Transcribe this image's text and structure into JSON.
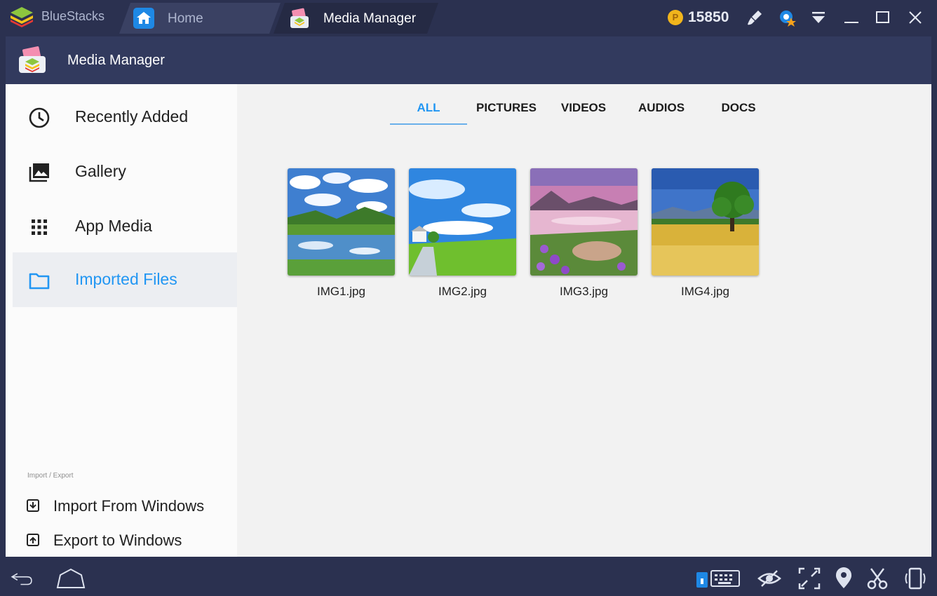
{
  "window": {
    "brand": "BlueStacks",
    "tabs": [
      {
        "label": "Home",
        "icon": "home-icon"
      },
      {
        "label": "Media Manager",
        "icon": "media-manager-icon"
      }
    ],
    "coins": "15850",
    "coin_symbol": "P",
    "toolbar_icons": [
      "brush-icon",
      "game-center-icon",
      "dropdown-icon",
      "minimize-icon",
      "maximize-icon",
      "close-icon"
    ]
  },
  "header": {
    "title": "Media Manager"
  },
  "sidebar": {
    "items": [
      {
        "label": "Recently Added",
        "icon": "clock-icon"
      },
      {
        "label": "Gallery",
        "icon": "gallery-icon"
      },
      {
        "label": "App Media",
        "icon": "grid-icon"
      },
      {
        "label": "Imported Files",
        "icon": "folder-icon",
        "active": true
      }
    ],
    "section_label": "Import / Export",
    "io": [
      {
        "label": "Import From Windows",
        "icon": "import-icon"
      },
      {
        "label": "Export to Windows",
        "icon": "export-icon"
      }
    ]
  },
  "content": {
    "tabs": [
      {
        "label": "ALL",
        "active": true
      },
      {
        "label": "PICTURES"
      },
      {
        "label": "VIDEOS"
      },
      {
        "label": "AUDIOS"
      },
      {
        "label": "DOCS"
      }
    ],
    "files": [
      {
        "name": "IMG1.jpg"
      },
      {
        "name": "IMG2.jpg"
      },
      {
        "name": "IMG3.jpg"
      },
      {
        "name": "IMG4.jpg"
      }
    ]
  },
  "bottom_icons": [
    "back-icon",
    "home-nav-icon",
    "keyboard-icon",
    "eye-icon",
    "resize-icon",
    "location-icon",
    "scissors-icon",
    "rotate-icon"
  ],
  "colors": {
    "accent": "#2196f3",
    "chrome": "#2b3150",
    "header": "#323a5e"
  }
}
